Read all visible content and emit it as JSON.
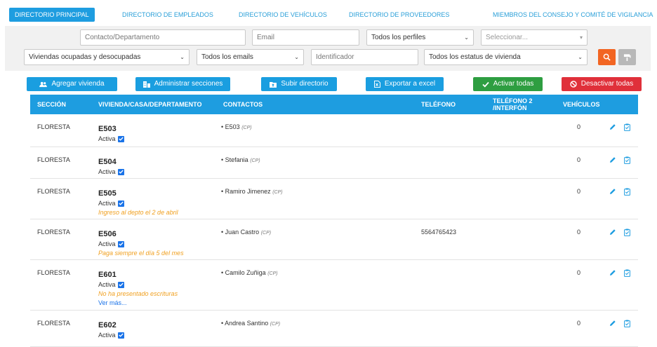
{
  "tabs": [
    {
      "label": "DIRECTORIO PRINCIPAL"
    },
    {
      "label": "DIRECTORIO DE EMPLEADOS"
    },
    {
      "label": "DIRECTORIO DE VEHÍCULOS"
    },
    {
      "label": "DIRECTORIO DE PROVEEDORES"
    },
    {
      "label": "MIEMBROS DEL CONSEJO Y COMITÉ DE VIGILANCIA"
    }
  ],
  "filters": {
    "contacto_placeholder": "Contacto/Departamento",
    "email_placeholder": "Email",
    "perfiles": "Todos los perfiles",
    "seleccionar": "Seleccionar...",
    "viviendas": "Viviendas ocupadas y desocupadas",
    "emails": "Todos los emails",
    "identificador_placeholder": "Identificador",
    "estatus": "Todos los estatus de vivienda"
  },
  "actions": {
    "agregar": "Agregar vivienda",
    "administrar": "Administrar secciones",
    "subir": "Subir directorio",
    "exportar": "Exportar a excel",
    "activar": "Activar todas",
    "desactivar": "Desactivar todas"
  },
  "headers": {
    "seccion": "SECCIÓN",
    "vivienda": "VIVIENDA/CASA/DEPARTAMENTO",
    "contactos": "CONTACTOS",
    "telefono": "TELÉFONO",
    "telefono2_line1": "TELÉFONO 2",
    "telefono2_line2": "/INTERFÓN",
    "vehiculos": "VEHÍCULOS"
  },
  "rows": [
    {
      "seccion": "FLORESTA",
      "unit": "E503",
      "status": "Activa",
      "note": "",
      "more": "",
      "contact": "E503",
      "cp": "(CP)",
      "tel": "",
      "veh": "0"
    },
    {
      "seccion": "FLORESTA",
      "unit": "E504",
      "status": "Activa",
      "note": "",
      "more": "",
      "contact": "Stefania",
      "cp": "(CP)",
      "tel": "",
      "veh": "0"
    },
    {
      "seccion": "FLORESTA",
      "unit": "E505",
      "status": "Activa",
      "note": "Ingreso al depto el 2 de abril",
      "more": "",
      "contact": "Ramiro Jimenez",
      "cp": "(CP)",
      "tel": "",
      "veh": "0"
    },
    {
      "seccion": "FLORESTA",
      "unit": "E506",
      "status": "Activa",
      "note": "Paga siempre el día 5 del mes",
      "more": "",
      "contact": "Juan Castro",
      "cp": "(CP)",
      "tel": "5564765423",
      "veh": "0"
    },
    {
      "seccion": "FLORESTA",
      "unit": "E601",
      "status": "Activa",
      "note": "No ha presentado escrituras",
      "more": "Ver más...",
      "contact": "Camilo Zuñiga",
      "cp": "(CP)",
      "tel": "",
      "veh": "0"
    },
    {
      "seccion": "FLORESTA",
      "unit": "E602",
      "status": "Activa",
      "note": "",
      "more": "",
      "contact": "Andrea Santino",
      "cp": "(CP)",
      "tel": "",
      "veh": "0"
    }
  ],
  "colors": {
    "primary": "#1e9de0",
    "green": "#2e9e41",
    "red": "#e0303a",
    "orange": "#f26522",
    "note": "#f0a020"
  }
}
